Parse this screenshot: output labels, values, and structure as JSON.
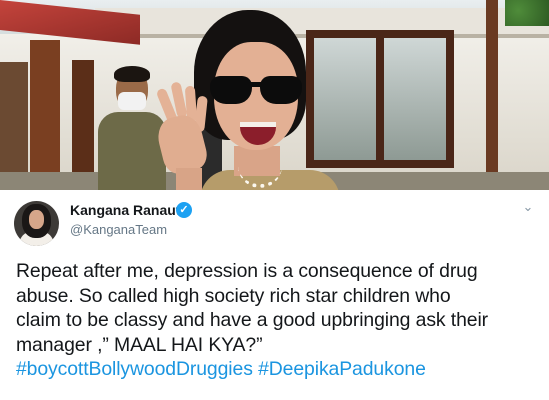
{
  "tweet": {
    "author_name": "Kangana Ranaut",
    "verified_glyph": "✓",
    "handle": "@KanganaTeam",
    "menu_glyph": "⌄",
    "text_lines": [
      "Repeat after me, depression is a consequence of drug",
      "abuse. So called high society rich star children who",
      "claim to be classy and have a good upbringing ask their",
      "manager ,” MAAL HAI KYA?”"
    ],
    "hashtags": [
      "#boycottBollywoodDruggies",
      "#DeepikaPadukone"
    ]
  },
  "colors": {
    "hashtag": "#1b95e0",
    "verified": "#1da1f2",
    "text": "#14171a",
    "handle": "#657786"
  },
  "icons": {
    "verified": "verified-badge-icon",
    "menu": "chevron-down-icon"
  }
}
